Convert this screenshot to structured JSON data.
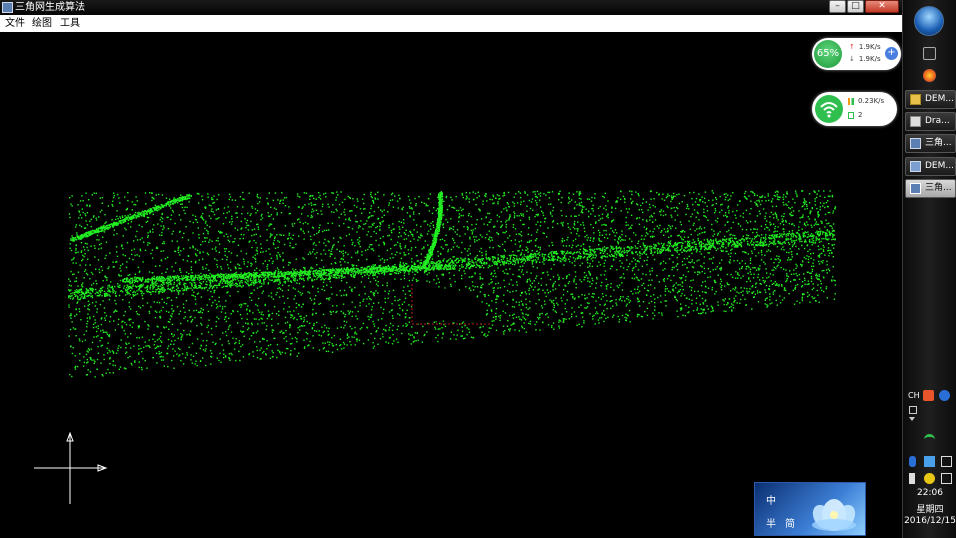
{
  "window": {
    "title": "三角网生成算法",
    "minimize_symbol": "–",
    "maximize_symbol": "□",
    "close_symbol": "✕"
  },
  "menu": {
    "file": "文件",
    "draw": "绘图",
    "tools": "工具"
  },
  "canvas": {
    "point_color": "#22ee22",
    "hole_color": "#b01818",
    "axis_color": "#ffffff"
  },
  "speed_widget": {
    "memory_percent": "65%",
    "upload": "1.9K/s",
    "download": "1.9K/s",
    "plus_symbol": "+"
  },
  "wifi_widget": {
    "rate": "0.23K/s",
    "devices": "2"
  },
  "ime": {
    "lang": "中",
    "width": "半",
    "mode": "简"
  },
  "taskbar": {
    "items": [
      {
        "label": "DEM...",
        "icon": "folder-icon"
      },
      {
        "label": "Dra...",
        "icon": "app-icon"
      },
      {
        "label": "三角...",
        "icon": "app-icon"
      },
      {
        "label": "DEM...",
        "icon": "app-icon"
      },
      {
        "label": "三角...",
        "icon": "app-icon"
      }
    ],
    "tray": {
      "lang": "CH"
    },
    "clock": {
      "time": "22:06",
      "weekday": "星期四",
      "date": "2016/12/15"
    }
  }
}
